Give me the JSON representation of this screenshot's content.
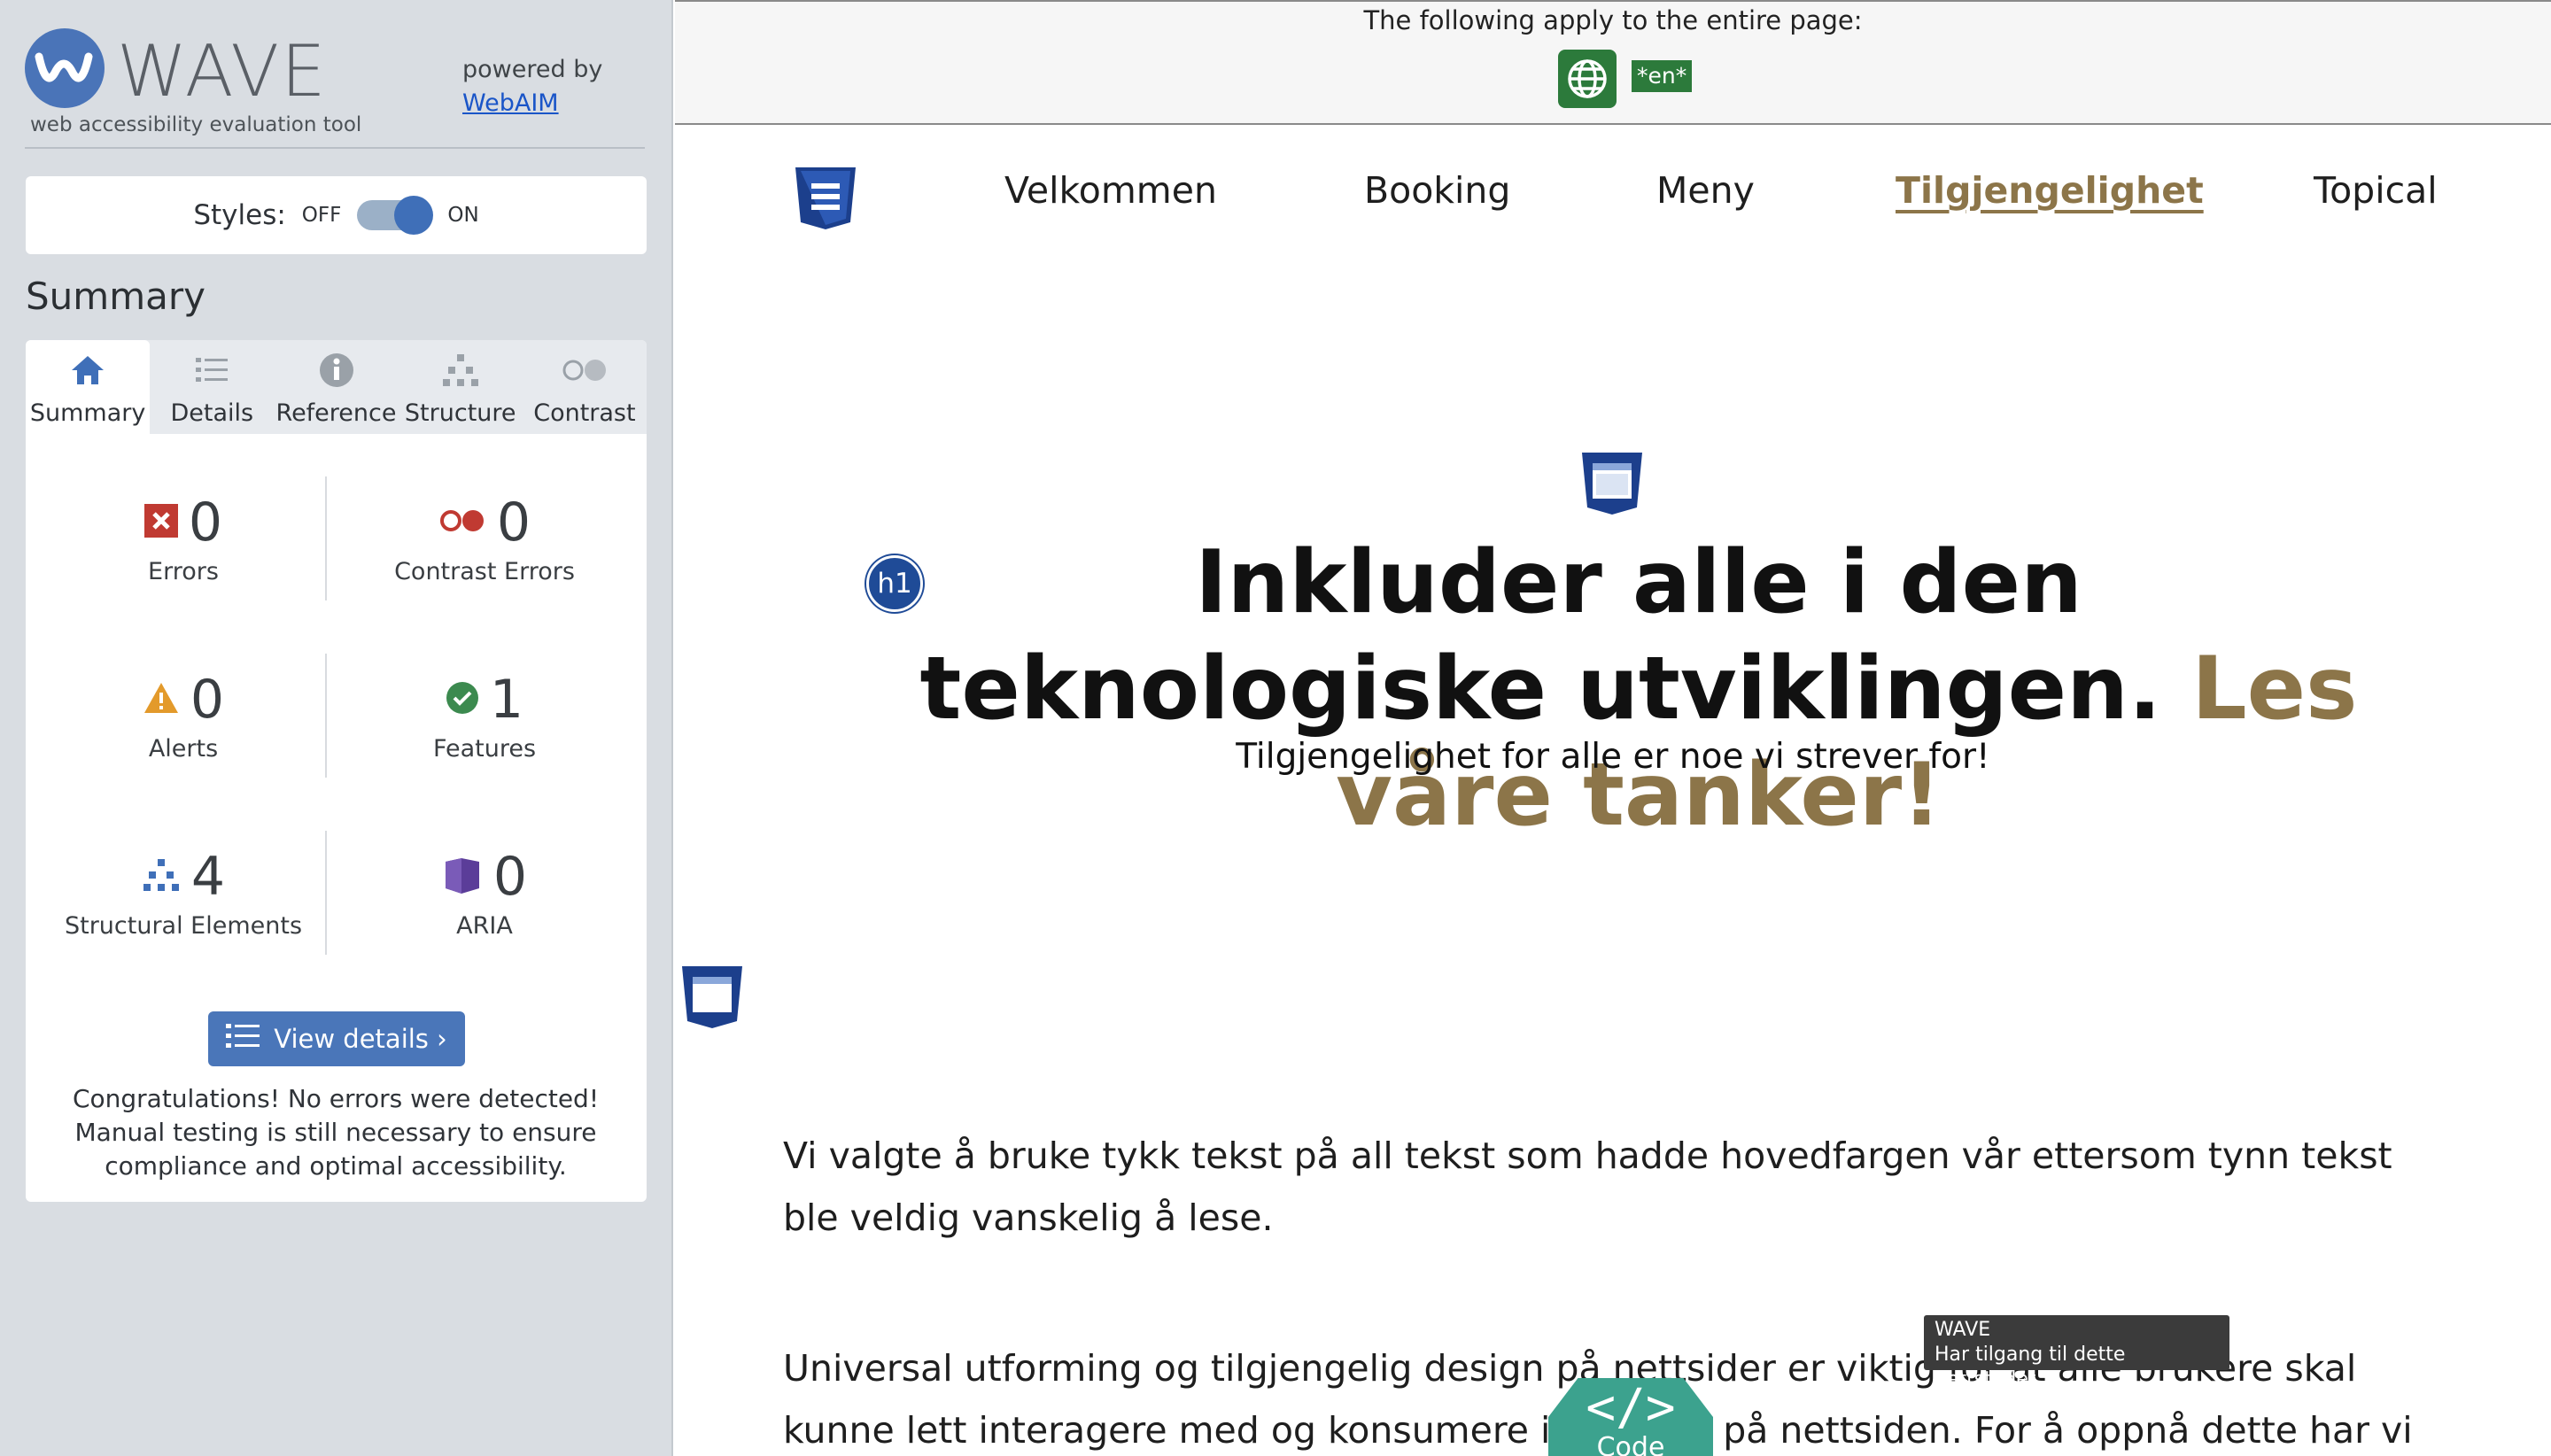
{
  "sidebar": {
    "logo_text": "WAVE",
    "tagline": "web accessibility evaluation tool",
    "powered_by": "powered by",
    "webaim_link": "WebAIM",
    "styles_label": "Styles:",
    "toggle_off": "OFF",
    "toggle_on": "ON",
    "summary_title": "Summary",
    "tabs": [
      {
        "label": "Summary",
        "icon": "home-icon"
      },
      {
        "label": "Details",
        "icon": "list-icon"
      },
      {
        "label": "Reference",
        "icon": "info-icon"
      },
      {
        "label": "Structure",
        "icon": "hierarchy-icon"
      },
      {
        "label": "Contrast",
        "icon": "contrast-icon"
      }
    ],
    "stats": {
      "errors": {
        "count": "0",
        "label": "Errors"
      },
      "contrast_errors": {
        "count": "0",
        "label": "Contrast Errors"
      },
      "alerts": {
        "count": "0",
        "label": "Alerts"
      },
      "features": {
        "count": "1",
        "label": "Features"
      },
      "structural": {
        "count": "4",
        "label": "Structural Elements"
      },
      "aria": {
        "count": "0",
        "label": "ARIA"
      }
    },
    "view_details": "View details ›",
    "congrats": "Congratulations! No errors were detected! Manual testing is still necessary to ensure compliance and optimal accessibility."
  },
  "page_banner": {
    "text": "The following apply to the entire page:",
    "lang_badge": "*en*"
  },
  "nav": {
    "items": [
      "Velkommen",
      "Booking",
      "Meny",
      "Tilgjengelighet",
      "Topical"
    ],
    "active": "Tilgjengelighet"
  },
  "hero": {
    "h1_badge": "h1",
    "title_main": "Inkluder alle i den teknologiske utviklingen.",
    "title_accent": "Les våre tanker!",
    "subtitle": "Tilgjengelighet for alle er noe vi strever for!"
  },
  "content": {
    "para1": "Vi valgte å bruke tykk tekst på all tekst som hadde hovedfargen vår ettersom tynn tekst ble veldig vanskelig å lese.",
    "para2": "Universal utforming og tilgjengelig design på nettsider er viktig for at alle brukere skal kunne lett interagere med og konsumere innholdet på nettsiden. For å oppnå dette har vi brukt"
  },
  "tooltip": {
    "title": "WAVE",
    "text": "Har tilgang til dette nettstedet"
  },
  "code_button": {
    "symbol": "</>",
    "label": "Code"
  },
  "colors": {
    "accent": "#8c7549",
    "wave_blue": "#4a76b9",
    "feature_green": "#2c7a3b",
    "code_teal": "#3ca28e"
  }
}
